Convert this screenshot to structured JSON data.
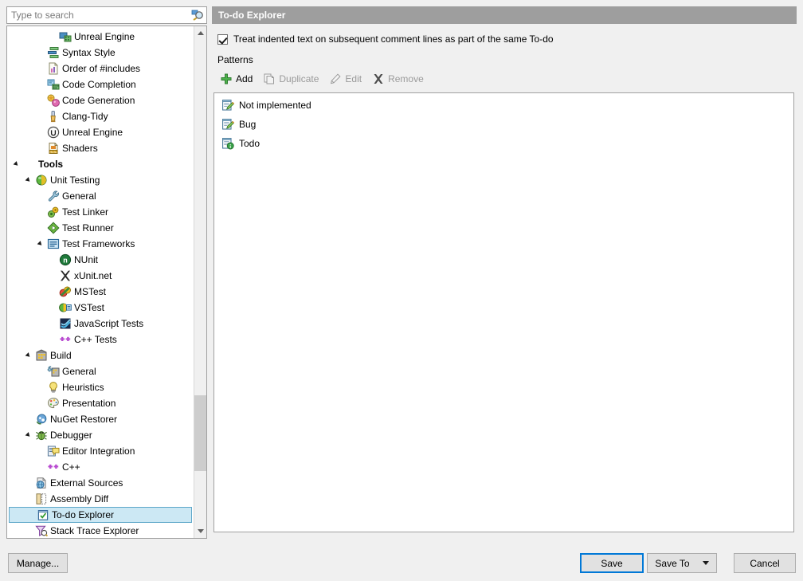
{
  "search": {
    "placeholder": "Type to search",
    "value": "",
    "icon": "search-icon"
  },
  "tree": {
    "items": [
      {
        "label": "Unreal Engine",
        "depth": 3,
        "icon": "unreal-engine-grid-icon",
        "expander": "none",
        "bold": false,
        "selected": false
      },
      {
        "label": "Syntax Style",
        "depth": 2,
        "icon": "syntax-style-icon",
        "expander": "none",
        "bold": false,
        "selected": false
      },
      {
        "label": "Order of #includes",
        "depth": 2,
        "icon": "order-includes-icon",
        "expander": "none",
        "bold": false,
        "selected": false
      },
      {
        "label": "Code Completion",
        "depth": 2,
        "icon": "code-completion-icon",
        "expander": "none",
        "bold": false,
        "selected": false
      },
      {
        "label": "Code Generation",
        "depth": 2,
        "icon": "code-generation-icon",
        "expander": "none",
        "bold": false,
        "selected": false
      },
      {
        "label": "Clang-Tidy",
        "depth": 2,
        "icon": "clang-tidy-icon",
        "expander": "none",
        "bold": false,
        "selected": false
      },
      {
        "label": "Unreal Engine",
        "depth": 2,
        "icon": "unreal-logo-icon",
        "expander": "none",
        "bold": false,
        "selected": false
      },
      {
        "label": "Shaders",
        "depth": 2,
        "icon": "shaders-hlsl-icon",
        "expander": "none",
        "bold": false,
        "selected": false
      },
      {
        "label": "Tools",
        "depth": 0,
        "icon": "none",
        "expander": "open",
        "bold": true,
        "selected": false
      },
      {
        "label": "Unit Testing",
        "depth": 1,
        "icon": "unit-testing-sphere-icon",
        "expander": "open",
        "bold": false,
        "selected": false
      },
      {
        "label": "General",
        "depth": 2,
        "icon": "wrench-icon",
        "expander": "none",
        "bold": false,
        "selected": false
      },
      {
        "label": "Test Linker",
        "depth": 2,
        "icon": "test-linker-icon",
        "expander": "none",
        "bold": false,
        "selected": false
      },
      {
        "label": "Test Runner",
        "depth": 2,
        "icon": "test-runner-play-icon",
        "expander": "none",
        "bold": false,
        "selected": false
      },
      {
        "label": "Test Frameworks",
        "depth": 2,
        "icon": "test-frameworks-icon",
        "expander": "open",
        "bold": false,
        "selected": false
      },
      {
        "label": "NUnit",
        "depth": 3,
        "icon": "nunit-icon",
        "expander": "none",
        "bold": false,
        "selected": false
      },
      {
        "label": "xUnit.net",
        "depth": 3,
        "icon": "xunit-icon",
        "expander": "none",
        "bold": false,
        "selected": false
      },
      {
        "label": "MSTest",
        "depth": 3,
        "icon": "mstest-icon",
        "expander": "none",
        "bold": false,
        "selected": false
      },
      {
        "label": "VSTest",
        "depth": 3,
        "icon": "vstest-icon",
        "expander": "none",
        "bold": false,
        "selected": false
      },
      {
        "label": "JavaScript Tests",
        "depth": 3,
        "icon": "javascript-tests-icon",
        "expander": "none",
        "bold": false,
        "selected": false
      },
      {
        "label": "C++ Tests",
        "depth": 3,
        "icon": "cpp-tests-icon",
        "expander": "none",
        "bold": false,
        "selected": false
      },
      {
        "label": "Build",
        "depth": 1,
        "icon": "build-icon",
        "expander": "open",
        "bold": false,
        "selected": false
      },
      {
        "label": "General",
        "depth": 2,
        "icon": "build-general-icon",
        "expander": "none",
        "bold": false,
        "selected": false
      },
      {
        "label": "Heuristics",
        "depth": 2,
        "icon": "lightbulb-icon",
        "expander": "none",
        "bold": false,
        "selected": false
      },
      {
        "label": "Presentation",
        "depth": 2,
        "icon": "palette-icon",
        "expander": "none",
        "bold": false,
        "selected": false
      },
      {
        "label": "NuGet Restorer",
        "depth": 1,
        "icon": "nuget-icon",
        "expander": "none",
        "bold": false,
        "selected": false
      },
      {
        "label": "Debugger",
        "depth": 1,
        "icon": "debugger-bug-icon",
        "expander": "open",
        "bold": false,
        "selected": false
      },
      {
        "label": "Editor Integration",
        "depth": 2,
        "icon": "editor-integration-icon",
        "expander": "none",
        "bold": false,
        "selected": false
      },
      {
        "label": "C++",
        "depth": 2,
        "icon": "cpp-tests-icon",
        "expander": "none",
        "bold": false,
        "selected": false
      },
      {
        "label": "External Sources",
        "depth": 1,
        "icon": "external-sources-icon",
        "expander": "none",
        "bold": false,
        "selected": false
      },
      {
        "label": "Assembly Diff",
        "depth": 1,
        "icon": "assembly-diff-icon",
        "expander": "none",
        "bold": false,
        "selected": false
      },
      {
        "label": "To-do Explorer",
        "depth": 1,
        "icon": "todo-explorer-icon",
        "expander": "none",
        "bold": false,
        "selected": true
      },
      {
        "label": "Stack Trace Explorer",
        "depth": 1,
        "icon": "stack-trace-icon",
        "expander": "none",
        "bold": false,
        "selected": false
      }
    ]
  },
  "pane": {
    "title": "To-do Explorer",
    "checkbox": {
      "label": "Treat indented text on subsequent comment lines as part of the same To-do",
      "checked": true
    },
    "patterns_label": "Patterns",
    "toolbar": [
      {
        "label": "Add",
        "icon": "add-plus-icon",
        "enabled": true
      },
      {
        "label": "Duplicate",
        "icon": "duplicate-icon",
        "enabled": false
      },
      {
        "label": "Edit",
        "icon": "edit-pencil-icon",
        "enabled": false
      },
      {
        "label": "Remove",
        "icon": "remove-x-icon",
        "enabled": false
      }
    ],
    "patterns": [
      {
        "label": "Not implemented",
        "icon": "note-pencil-icon"
      },
      {
        "label": "Bug",
        "icon": "note-pencil-icon"
      },
      {
        "label": "Todo",
        "icon": "note-info-icon"
      }
    ]
  },
  "footer": {
    "manage": "Manage...",
    "save": "Save",
    "save_to": "Save To",
    "cancel": "Cancel"
  },
  "colors": {
    "header_bar": "#9e9e9e",
    "selection_bg": "#cce8f4",
    "selection_border": "#5ea7c9",
    "focus_blue": "#0078d7",
    "window_bg": "#f0f0f0",
    "add_green": "#3aa03a"
  }
}
